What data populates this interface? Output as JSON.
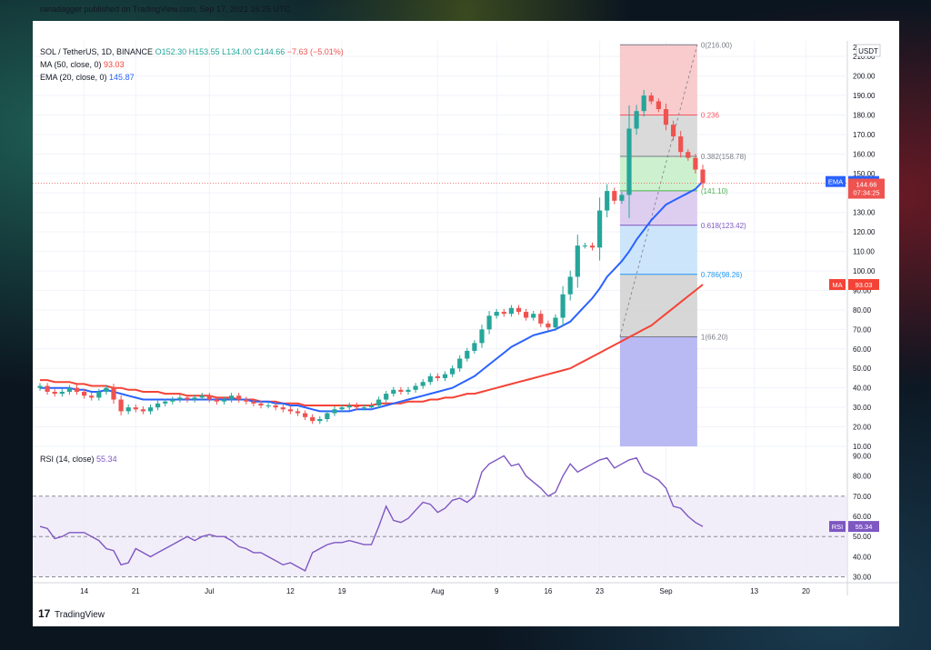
{
  "publisher_line": "ranadagger published on TradingView.com, Sep 17, 2021 16:25 UTC",
  "symbol_line": {
    "symbol": "SOL / TetherUS, 1D, BINANCE",
    "o": "O152.30",
    "h": "H153.55",
    "l": "L134.00",
    "c": "C144.66",
    "change": "−7.63 (−5.01%)"
  },
  "ma_line": {
    "label": "MA (50, close, 0)",
    "value": "93.03"
  },
  "ema_line": {
    "label": "EMA (20, close, 0)",
    "value": "145.87"
  },
  "rsi_line": {
    "label": "RSI (14, close)",
    "value": "55.34"
  },
  "currency": "USDT",
  "badges": {
    "ema": {
      "label": "EMA",
      "value": "145.87"
    },
    "price": {
      "value": "144.66",
      "countdown": "07:34:25"
    },
    "ma": {
      "label": "MA",
      "value": "93.03"
    },
    "rsi": {
      "label": "RSI",
      "value": "55.34"
    }
  },
  "fib_levels": [
    {
      "ratio": "0",
      "price": 216.0,
      "label": "0(216.00)",
      "color": "#787b86"
    },
    {
      "ratio": "0.236",
      "price": 180.0,
      "label": "0.236",
      "color": "#f7525f"
    },
    {
      "ratio": "0.382",
      "price": 158.78,
      "label": "0.382(158.78)",
      "color": "#787b86"
    },
    {
      "ratio": "0.5",
      "price": 141.1,
      "label": "(141.10)",
      "color": "#4caf50"
    },
    {
      "ratio": "0.618",
      "price": 123.42,
      "label": "0.618(123.42)",
      "color": "#7e57c2"
    },
    {
      "ratio": "0.786",
      "price": 98.26,
      "label": "0.786(98.26)",
      "color": "#2196f3"
    },
    {
      "ratio": "1",
      "price": 66.2,
      "label": "1(66.20)",
      "color": "#787b86"
    }
  ],
  "brand": "TradingView",
  "colors": {
    "up": "#26a69a",
    "down": "#ef5350",
    "ema": "#2962ff",
    "ma": "#f44336",
    "rsi": "#7e57c2"
  },
  "chart_data": [
    {
      "type": "candlestick",
      "title": "SOL / TetherUS, 1D, BINANCE",
      "ylabel": "USDT",
      "yticks": [
        10,
        20,
        30,
        40,
        50,
        60,
        70,
        80,
        90,
        100,
        110,
        120,
        130,
        140,
        150,
        160,
        170,
        180,
        190,
        200,
        210
      ],
      "ylim": [
        10,
        218
      ],
      "xticks": [
        {
          "label": "14",
          "date": "2021-06-14"
        },
        {
          "label": "21",
          "date": "2021-06-21"
        },
        {
          "label": "Jul",
          "date": "2021-07-01"
        },
        {
          "label": "12",
          "date": "2021-07-12"
        },
        {
          "label": "19",
          "date": "2021-07-19"
        },
        {
          "label": "Aug",
          "date": "2021-08-01"
        },
        {
          "label": "9",
          "date": "2021-08-09"
        },
        {
          "label": "16",
          "date": "2021-08-16"
        },
        {
          "label": "23",
          "date": "2021-08-23"
        },
        {
          "label": "Sep",
          "date": "2021-09-01"
        },
        {
          "label": "13",
          "date": "2021-09-13"
        },
        {
          "label": "20",
          "date": "2021-09-20"
        }
      ],
      "start_date": "2021-06-08",
      "close": [
        41,
        38,
        37,
        38,
        40,
        38,
        36,
        35,
        38,
        40,
        34,
        28,
        30,
        29,
        28,
        30,
        32,
        33,
        34,
        35,
        34,
        35,
        36,
        34,
        33,
        34,
        36,
        34,
        33,
        32,
        31,
        31,
        30,
        29,
        28,
        27,
        25,
        23,
        24,
        27,
        29,
        30,
        31,
        30,
        30,
        31,
        34,
        37,
        39,
        38,
        39,
        41,
        43,
        46,
        45,
        47,
        50,
        55,
        59,
        63,
        70,
        77,
        79,
        78,
        81,
        79,
        76,
        78,
        73,
        71,
        76,
        88,
        97,
        113,
        113,
        112,
        131,
        141,
        136,
        139,
        173,
        182,
        190,
        187,
        183,
        175,
        169,
        161,
        158,
        152,
        145
      ],
      "ema20": [
        40,
        40,
        40,
        40,
        40,
        39,
        39,
        38,
        38,
        39,
        38,
        37,
        36,
        35,
        34,
        34,
        34,
        34,
        34,
        34,
        34,
        34,
        34,
        34,
        34,
        34,
        34,
        34,
        34,
        33,
        33,
        33,
        32,
        32,
        31,
        31,
        30,
        29,
        28,
        28,
        28,
        28,
        28,
        29,
        29,
        29,
        30,
        31,
        32,
        33,
        34,
        35,
        36,
        37,
        38,
        39,
        40,
        42,
        44,
        46,
        49,
        52,
        55,
        58,
        61,
        63,
        65,
        67,
        68,
        69,
        70,
        72,
        74,
        78,
        82,
        86,
        91,
        97,
        101,
        105,
        110,
        116,
        121,
        126,
        130,
        134,
        136,
        138,
        140,
        142,
        146
      ],
      "ma50": [
        44,
        44,
        43,
        43,
        43,
        42,
        42,
        41,
        41,
        41,
        40,
        40,
        39,
        39,
        38,
        38,
        38,
        37,
        37,
        37,
        36,
        36,
        36,
        36,
        35,
        35,
        35,
        34,
        34,
        34,
        33,
        33,
        33,
        32,
        32,
        32,
        31,
        31,
        31,
        31,
        31,
        31,
        31,
        31,
        31,
        31,
        32,
        32,
        32,
        32,
        33,
        33,
        33,
        34,
        34,
        35,
        35,
        36,
        37,
        37,
        38,
        39,
        40,
        41,
        42,
        43,
        44,
        45,
        46,
        47,
        48,
        49,
        50,
        52,
        54,
        56,
        58,
        60,
        62,
        64,
        66,
        68,
        70,
        72,
        75,
        78,
        81,
        84,
        87,
        90,
        93
      ]
    },
    {
      "type": "line",
      "title": "RSI (14, close)",
      "ylim": [
        28,
        92
      ],
      "yticks": [
        30,
        40,
        50,
        60,
        70,
        80,
        90
      ],
      "bands": {
        "upper": 70,
        "middle": 50,
        "lower": 30
      },
      "values": [
        55,
        54,
        49,
        50,
        52,
        52,
        52,
        50,
        48,
        44,
        43,
        36,
        37,
        44,
        42,
        40,
        42,
        44,
        46,
        48,
        50,
        48,
        50,
        51,
        50,
        50,
        48,
        45,
        44,
        42,
        42,
        40,
        38,
        36,
        37,
        35,
        33,
        42,
        44,
        46,
        47,
        47,
        48,
        47,
        46,
        46,
        55,
        65,
        58,
        57,
        59,
        63,
        67,
        66,
        62,
        64,
        68,
        69,
        67,
        70,
        82,
        86,
        88,
        90,
        85,
        86,
        80,
        77,
        74,
        70,
        72,
        80,
        86,
        82,
        84,
        86,
        88,
        89,
        84,
        86,
        88,
        89,
        82,
        80,
        78,
        74,
        65,
        64,
        60,
        57,
        55
      ]
    }
  ]
}
